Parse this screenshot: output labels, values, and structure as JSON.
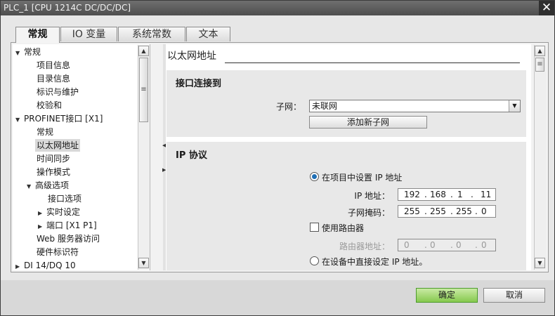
{
  "window": {
    "title": "PLC_1 [CPU 1214C DC/DC/DC]",
    "close_glyph": "✕"
  },
  "tabs": [
    {
      "label": "常规",
      "active": true
    },
    {
      "label": "IO 变量",
      "active": false
    },
    {
      "label": "系统常数",
      "active": false
    },
    {
      "label": "文本",
      "active": false
    }
  ],
  "tree": [
    {
      "label": "常规",
      "arrow": "▼"
    },
    {
      "label": "项目信息",
      "arrow": ""
    },
    {
      "label": "目录信息",
      "arrow": ""
    },
    {
      "label": "标识与维护",
      "arrow": ""
    },
    {
      "label": "校验和",
      "arrow": ""
    },
    {
      "label": "PROFINET接口 [X1]",
      "arrow": "▼"
    },
    {
      "label": "常规",
      "arrow": ""
    },
    {
      "label": "以太网地址",
      "arrow": "",
      "selected": true
    },
    {
      "label": "时间同步",
      "arrow": ""
    },
    {
      "label": "操作模式",
      "arrow": ""
    },
    {
      "label": "高级选项",
      "arrow": "▼"
    },
    {
      "label": "接口选项",
      "arrow": ""
    },
    {
      "label": "实时设定",
      "arrow": "▶"
    },
    {
      "label": "端口 [X1 P1]",
      "arrow": "▶"
    },
    {
      "label": "Web 服务器访问",
      "arrow": ""
    },
    {
      "label": "硬件标识符",
      "arrow": ""
    },
    {
      "label": "DI 14/DQ 10",
      "arrow": "▶"
    }
  ],
  "main": {
    "section_title": "以太网地址",
    "interface": {
      "header": "接口连接到",
      "subnet_label": "子网：",
      "subnet_value": "未联网",
      "add_subnet_button": "添加新子网"
    },
    "ip": {
      "header": "IP 协议",
      "set_in_project_label": "在项目中设置 IP 地址",
      "set_in_project_selected": true,
      "ip_label": "IP 地址：",
      "ip_octets": [
        "192",
        "168",
        "1",
        "11"
      ],
      "mask_label": "子网掩码：",
      "mask_octets": [
        "255",
        "255",
        "255",
        "0"
      ],
      "use_router_label": "使用路由器",
      "use_router_checked": false,
      "router_label": "路由器地址：",
      "router_octets": [
        "0",
        "0",
        "0",
        "0"
      ],
      "set_on_device_label": "在设备中直接设定 IP 地址。",
      "set_on_device_selected": false
    }
  },
  "footer": {
    "ok": "确定",
    "cancel": "取消"
  },
  "icons": {
    "scroll_up": "▲",
    "scroll_down": "▼",
    "grip": "≡",
    "dropdown": "▼",
    "splitter_left": "◀",
    "splitter_right": "▶"
  },
  "colors": {
    "ok_button": "#86c94e",
    "selected_row": "#d9d9d9",
    "radio_dot": "#1f6fb5"
  }
}
